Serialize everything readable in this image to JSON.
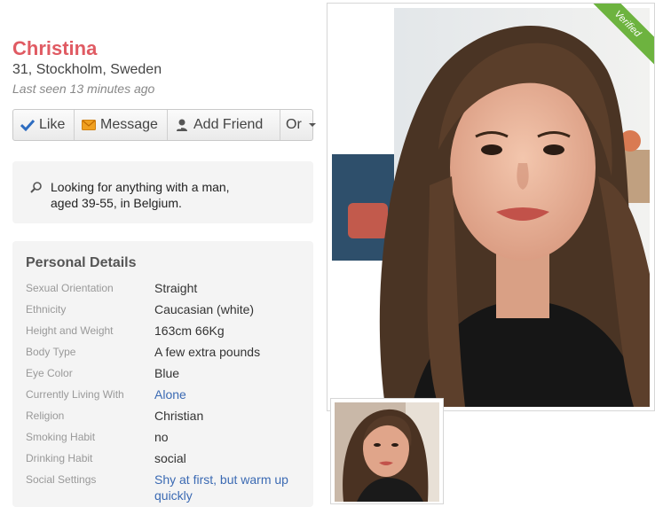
{
  "profile": {
    "name": "Christina",
    "meta": "31, Stockholm, Sweden",
    "last_seen": "Last seen 13 minutes ago"
  },
  "actions": {
    "like": "Like",
    "message": "Message",
    "add_friend": "Add Friend",
    "or": "Or"
  },
  "looking_for": {
    "icon": "search-icon",
    "line1": "Looking for anything with a man,",
    "line2": "aged 39-55, in Belgium."
  },
  "details": {
    "title": "Personal Details",
    "rows": [
      {
        "label": "Sexual Orientation",
        "value": "Straight"
      },
      {
        "label": "Ethnicity",
        "value": "Caucasian (white)"
      },
      {
        "label": "Height and Weight",
        "value": "163cm 66Kg"
      },
      {
        "label": "Body Type",
        "value": "A few extra pounds"
      },
      {
        "label": "Eye Color",
        "value": "Blue"
      },
      {
        "label": "Currently Living With",
        "value": "Alone"
      },
      {
        "label": "Religion",
        "value": "Christian"
      },
      {
        "label": "Smoking Habit",
        "value": "no"
      },
      {
        "label": "Drinking Habit",
        "value": "social"
      },
      {
        "label": "Social Settings",
        "value": "Shy at first, but warm up quickly"
      }
    ]
  },
  "photo": {
    "badge": "Verified"
  },
  "colors": {
    "name": "#e05b63",
    "link": "#3b6ab3",
    "verified": "#6db33f"
  }
}
